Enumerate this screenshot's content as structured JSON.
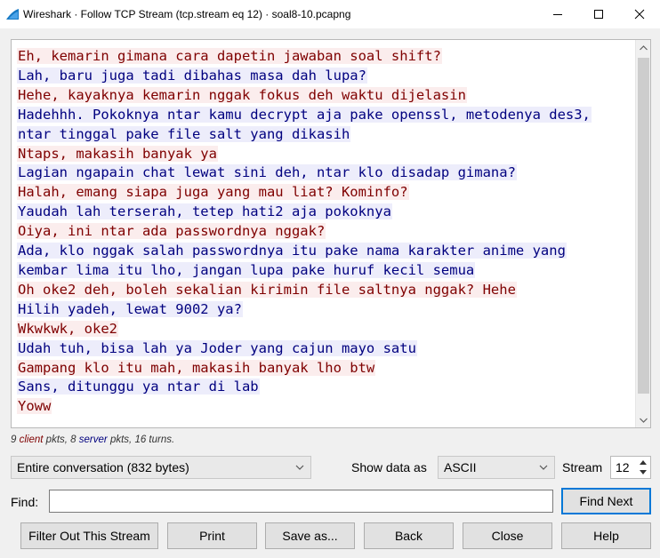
{
  "window": {
    "title": "Wireshark · Follow TCP Stream (tcp.stream eq 12) · soal8-10.pcapng",
    "app_icon": "wireshark-fin-icon",
    "controls": [
      "minimize-icon",
      "maximize-icon",
      "close-icon"
    ]
  },
  "stream": {
    "lines": [
      {
        "side": "client",
        "text": "Eh, kemarin gimana cara dapetin jawaban soal shift?"
      },
      {
        "side": "server",
        "text": "Lah, baru juga tadi dibahas masa dah lupa?"
      },
      {
        "side": "client",
        "text": "Hehe, kayaknya kemarin nggak fokus deh waktu dijelasin"
      },
      {
        "side": "server",
        "text": "Hadehhh. Pokoknya ntar kamu decrypt aja pake openssl, metodenya des3,"
      },
      {
        "side": "server",
        "text": "ntar tinggal pake file salt yang dikasih"
      },
      {
        "side": "client",
        "text": "Ntaps, makasih banyak ya"
      },
      {
        "side": "server",
        "text": "Lagian ngapain chat lewat sini deh, ntar klo disadap gimana?"
      },
      {
        "side": "client",
        "text": "Halah, emang siapa juga yang mau liat? Kominfo?"
      },
      {
        "side": "server",
        "text": "Yaudah lah terserah, tetep hati2 aja pokoknya"
      },
      {
        "side": "client",
        "text": "Oiya, ini ntar ada passwordnya nggak?"
      },
      {
        "side": "server",
        "text": "Ada, klo nggak salah passwordnya itu pake nama karakter anime yang"
      },
      {
        "side": "server",
        "text": "kembar lima itu lho, jangan lupa pake huruf kecil semua"
      },
      {
        "side": "client",
        "text": "Oh oke2 deh, boleh sekalian kirimin file saltnya nggak? Hehe"
      },
      {
        "side": "server",
        "text": "Hilih yadeh, lewat 9002 ya?"
      },
      {
        "side": "client",
        "text": "Wkwkwk, oke2"
      },
      {
        "side": "server",
        "text": "Udah tuh, bisa lah ya Joder yang cajun mayo satu"
      },
      {
        "side": "client",
        "text": "Gampang klo itu mah, makasih banyak lho btw"
      },
      {
        "side": "server",
        "text": "Sans, ditunggu ya ntar di lab"
      },
      {
        "side": "client",
        "text": "Yoww"
      }
    ],
    "colors": {
      "client_fg": "#7f0000",
      "client_bg": "#fbeded",
      "server_fg": "#00007f",
      "server_bg": "#ededfb"
    }
  },
  "stats": {
    "client_count": "9",
    "client_word": "client",
    "pkts_label": "pkts,",
    "server_count": "8",
    "server_word": "server",
    "turns": "16 turns."
  },
  "controls": {
    "conversation_select": "Entire conversation (832 bytes)",
    "show_data_label": "Show data as",
    "show_data_value": "ASCII",
    "stream_label": "Stream",
    "stream_value": "12",
    "find_label": "Find:",
    "find_value": "",
    "find_next": "Find Next"
  },
  "buttons": {
    "filter_out": "Filter Out This Stream",
    "print": "Print",
    "save_as": "Save as...",
    "back": "Back",
    "close": "Close",
    "help": "Help"
  }
}
